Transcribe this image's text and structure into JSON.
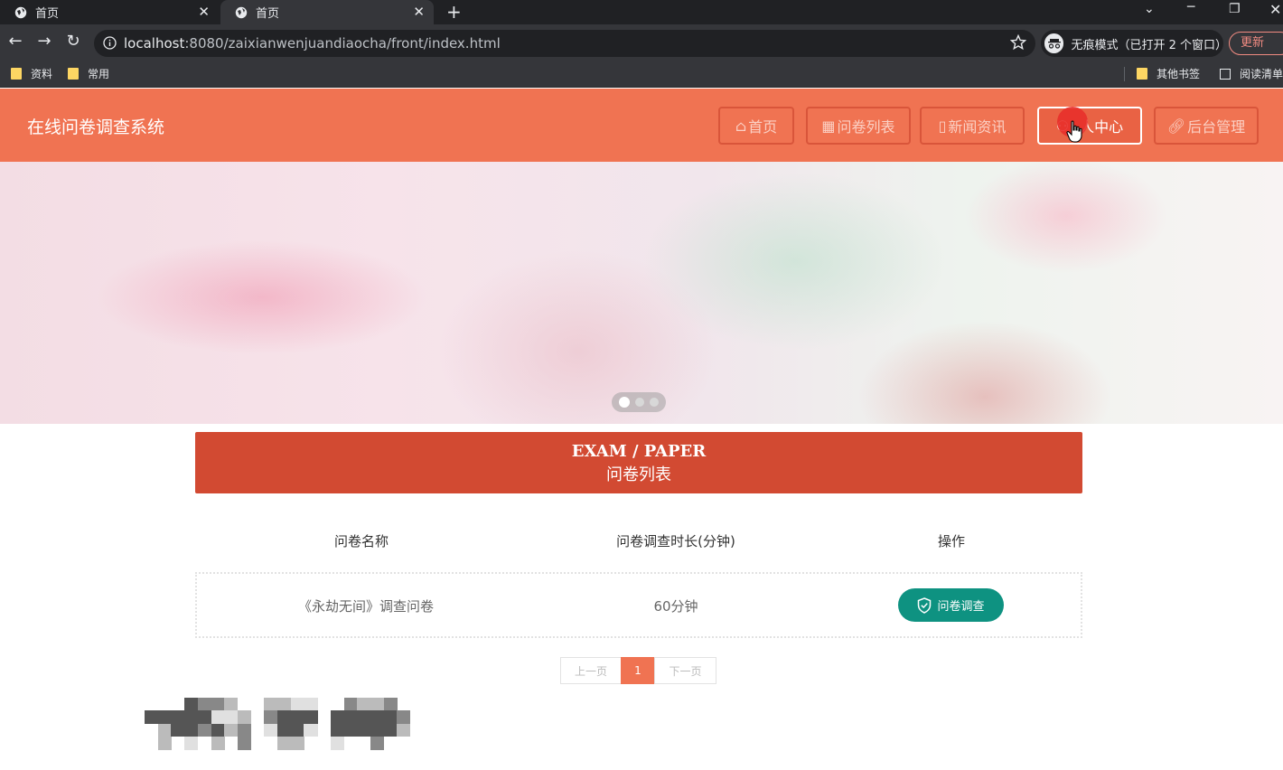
{
  "browser": {
    "tabs": [
      {
        "title": "首页",
        "active": false
      },
      {
        "title": "首页",
        "active": true
      }
    ],
    "url_host": "localhost",
    "url_rest": ":8080/zaixianwenjuandiaocha/front/index.html",
    "incognito_label": "无痕模式（已打开 2 个窗口）",
    "update_label": "更新",
    "bookmarks": [
      "资料",
      "常用"
    ],
    "bookmarks_right": [
      "其他书签",
      "阅读清单"
    ]
  },
  "site": {
    "title": "在线问卷调查系统",
    "nav": [
      {
        "label": "首页",
        "icon": "home-icon"
      },
      {
        "label": "问卷列表",
        "icon": "list-icon"
      },
      {
        "label": "新闻资讯",
        "icon": "news-icon"
      },
      {
        "label": "人中心",
        "icon": "user-icon"
      },
      {
        "label": "后台管理",
        "icon": "link-icon"
      }
    ]
  },
  "section": {
    "title_en": "EXAM / PAPER",
    "title_cn": "问卷列表"
  },
  "table": {
    "headers": [
      "问卷名称",
      "问卷调查时长(分钟)",
      "操作"
    ],
    "rows": [
      {
        "name": "《永劫无间》调查问卷",
        "duration": "60分钟",
        "action": "问卷调查"
      }
    ]
  },
  "pager": {
    "prev": "上一页",
    "current": "1",
    "next": "下一页"
  },
  "colors": {
    "header_bg": "#f07352",
    "section_bg": "#d24a32",
    "action_btn": "#0e9281"
  }
}
